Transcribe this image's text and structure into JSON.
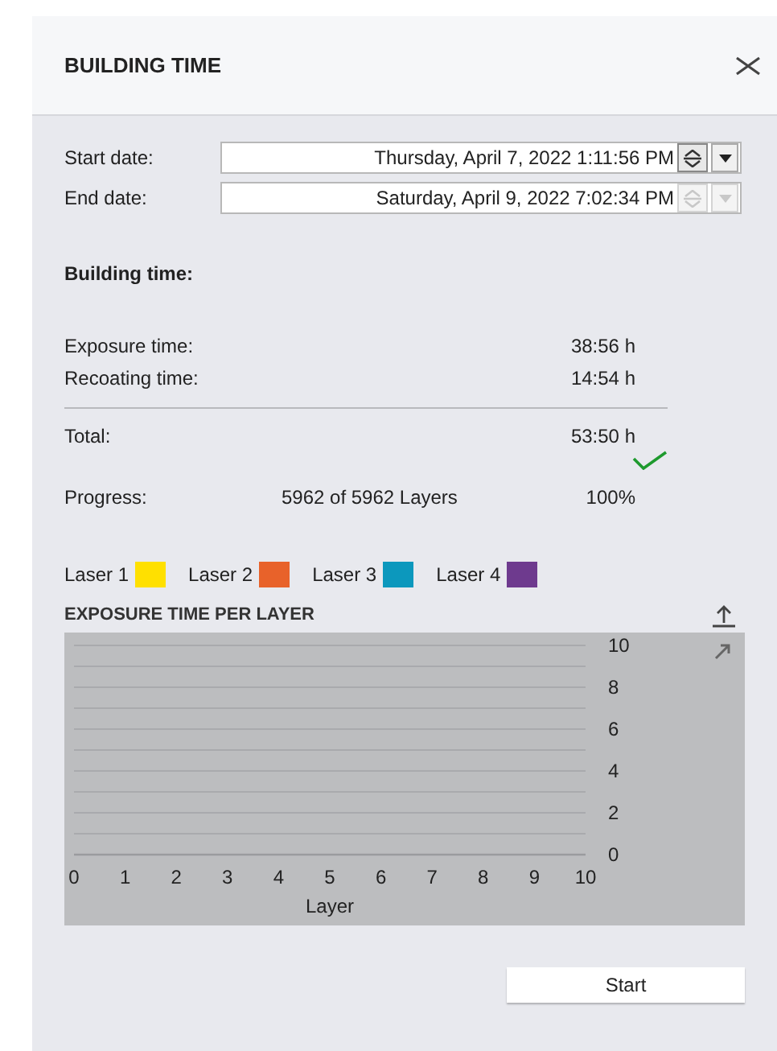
{
  "dialog": {
    "title": "BUILDING TIME"
  },
  "dates": [
    {
      "label": "Start date:",
      "value": "Thursday, April 7, 2022 1:11:56 PM",
      "disabled": false
    },
    {
      "label": "End date:",
      "value": "Saturday, April 9, 2022 7:02:34 PM",
      "disabled": true
    }
  ],
  "building_time": {
    "heading": "Building time:",
    "rows": [
      {
        "label": "Exposure time:",
        "value": "38:56 h"
      },
      {
        "label": "Recoating time:",
        "value": "14:54 h"
      }
    ],
    "total": {
      "label": "Total:",
      "value": "53:50 h"
    },
    "complete": true,
    "progress": {
      "label": "Progress:",
      "layers": "5962 of 5962 Layers",
      "percent": "100%"
    }
  },
  "lasers": [
    {
      "label": "Laser 1",
      "color": "#ffe000"
    },
    {
      "label": "Laser 2",
      "color": "#e8622a"
    },
    {
      "label": "Laser 3",
      "color": "#0c98bd"
    },
    {
      "label": "Laser 4",
      "color": "#6e3a8e"
    }
  ],
  "chart": {
    "title": "EXPOSURE TIME PER LAYER",
    "chart_data": {
      "type": "line",
      "grid": true,
      "xlabel": "Layer",
      "xlim": [
        0,
        10
      ],
      "ylim": [
        0,
        10
      ],
      "xticks": [
        0,
        1,
        2,
        3,
        4,
        5,
        6,
        7,
        8,
        9,
        10
      ],
      "yticks": [
        0,
        2,
        4,
        6,
        8,
        10
      ]
    }
  },
  "buttons": [
    {
      "label": "Start"
    }
  ]
}
